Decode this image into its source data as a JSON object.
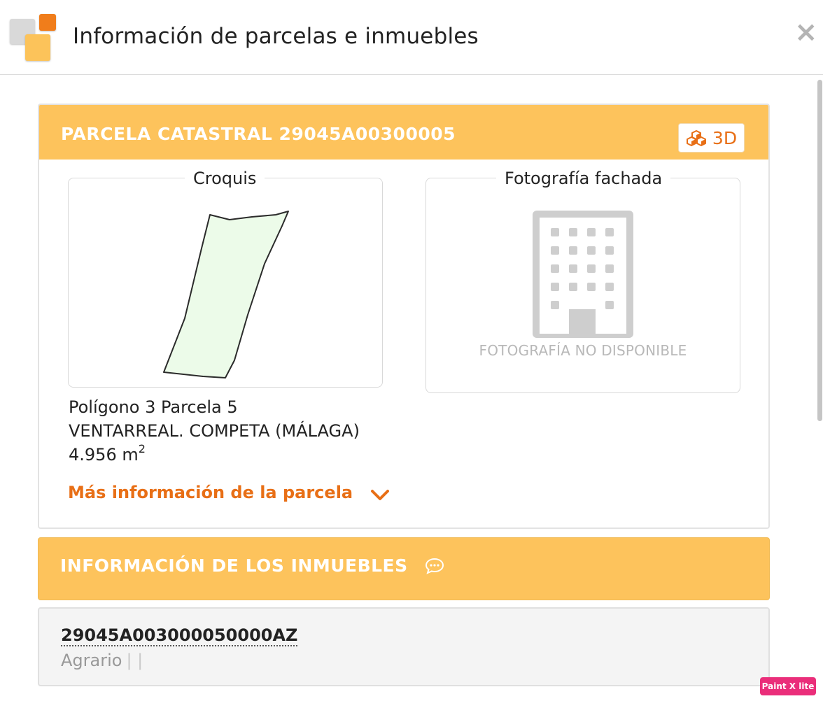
{
  "header": {
    "title": "Información de parcelas e inmuebles",
    "close_label": "×"
  },
  "parcel": {
    "title": "PARCELA CATASTRAL 29045A00300005",
    "btn_3d_label": "3D",
    "sketch_legend": "Croquis",
    "photo_legend": "Fotografía fachada",
    "photo_unavailable": "FOTOGRAFÍA NO DISPONIBLE",
    "location_line": "Polígono 3 Parcela 5",
    "place_line": "VENTARREAL. COMPETA (MÁLAGA)",
    "area_value": "4.956 m",
    "area_unit_sup": "2",
    "more_info_label": "Más información de la parcela"
  },
  "properties": {
    "title": "INFORMACIÓN DE LOS INMUEBLES",
    "items": [
      {
        "reference": "29045A003000050000AZ",
        "use": "Agrario",
        "separators": "| |"
      }
    ]
  },
  "watermark": "Paint X lite",
  "colors": {
    "accent_orange": "#e86f16",
    "header_yellow": "#fdc35c",
    "parcel_fill": "#ecfbe9"
  },
  "icons": {
    "app_logo": "app-logo-icon",
    "close": "close-icon",
    "cubes": "cubes-icon",
    "building": "building-icon",
    "chevron": "chevron-down-icon",
    "comment": "comment-icon"
  }
}
